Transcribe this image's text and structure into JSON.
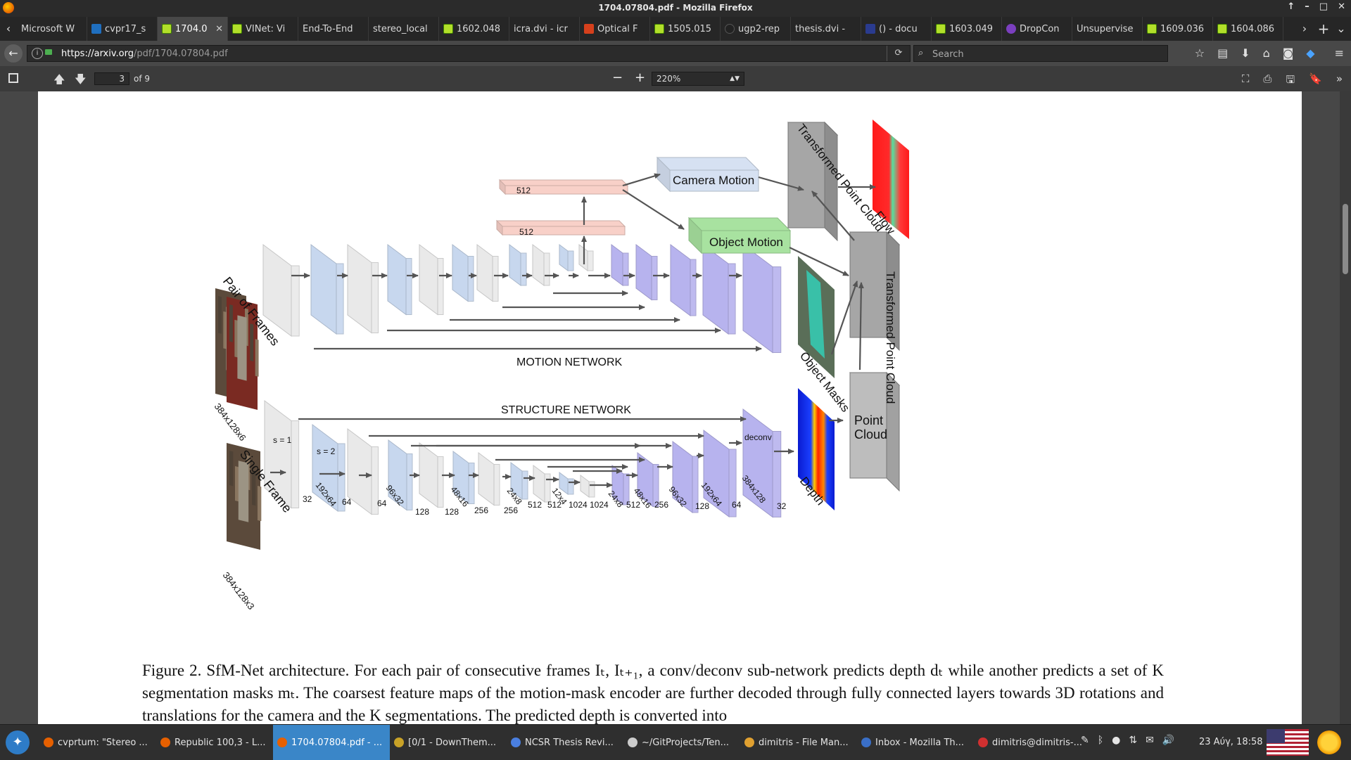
{
  "window": {
    "title": "1704.07804.pdf - Mozilla Firefox"
  },
  "tabs": [
    {
      "label": "Microsoft W",
      "icon": "none",
      "active": false
    },
    {
      "label": "cvpr17_s",
      "icon": "ieee",
      "active": false
    },
    {
      "label": "1704.0",
      "icon": "arxiv",
      "active": true
    },
    {
      "label": "VINet: Vi",
      "icon": "arxiv",
      "active": false
    },
    {
      "label": "End-To-End",
      "icon": "none",
      "active": false
    },
    {
      "label": "stereo_local",
      "icon": "none",
      "active": false
    },
    {
      "label": "1602.048",
      "icon": "arxiv",
      "active": false
    },
    {
      "label": "icra.dvi - icr",
      "icon": "none",
      "active": false
    },
    {
      "label": "Optical F",
      "icon": "r",
      "active": false
    },
    {
      "label": "1505.015",
      "icon": "arxiv",
      "active": false
    },
    {
      "label": "ugp2-rep",
      "icon": "github",
      "active": false
    },
    {
      "label": "thesis.dvi -",
      "icon": "none",
      "active": false
    },
    {
      "label": "() - docu",
      "icon": "hal",
      "active": false
    },
    {
      "label": "1603.049",
      "icon": "arxiv",
      "active": false
    },
    {
      "label": "DropCon",
      "icon": "drop",
      "active": false
    },
    {
      "label": "Unsupervise",
      "icon": "none",
      "active": false
    },
    {
      "label": "1609.036",
      "icon": "arxiv",
      "active": false
    },
    {
      "label": "1604.086",
      "icon": "arxiv",
      "active": false
    }
  ],
  "nav": {
    "url_host": "https://arxiv.org",
    "url_path": "/pdf/1704.07804.pdf",
    "search_placeholder": "Search"
  },
  "pdf": {
    "page_current": "3",
    "page_total": "of 9",
    "zoom": "220%"
  },
  "figure": {
    "labels": {
      "pair_of_frames": "Pair of Frames",
      "pair_dims": "384x128x6",
      "single_frame": "Single Frame",
      "single_dims": "384x128x3",
      "motion_network": "MOTION NETWORK",
      "structure_network": "STRUCTURE NETWORK",
      "camera_motion": "Camera Motion",
      "object_motion": "Object Motion",
      "fc1": "512",
      "fc2": "512",
      "transformed_pc_top": "Transformed Point Cloud",
      "transformed_pc_mid": "Transformed Point Cloud",
      "point_cloud": "Point Cloud",
      "flow": "Flow",
      "object_masks": "Object Masks",
      "depth": "Depth",
      "deconv": "deconv",
      "s1": "s = 1",
      "s2": "s = 2"
    },
    "bottom_numbers": [
      "32",
      "64",
      "64",
      "128",
      "128",
      "256",
      "256",
      "512",
      "512",
      "1024",
      "1024",
      "512",
      "256",
      "128",
      "64",
      "32"
    ],
    "bottom_dims": [
      "192x64",
      "96x32",
      "48x16",
      "24x8",
      "12x4",
      "24x8",
      "48x16",
      "96x32",
      "192x64",
      "384x128"
    ]
  },
  "caption": {
    "text": "Figure 2.  SfM-Net architecture. For each pair of consecutive frames Iₜ, Iₜ₊₁, a conv/deconv sub-network predicts depth dₜ while another predicts a set of K segmentation masks mₜ.  The coarsest feature maps of the motion-mask encoder are further decoded through fully connected layers towards 3D rotations and translations for the camera and the K segmentations.  The predicted depth is converted into"
  },
  "taskbar": {
    "tasks": [
      {
        "label": "cvprtum: \"Stereo ...",
        "color": "#e66000",
        "active": false
      },
      {
        "label": "Republic 100,3 - L...",
        "color": "#e66000",
        "active": false
      },
      {
        "label": "1704.07804.pdf - ...",
        "color": "#e66000",
        "active": true
      },
      {
        "label": "[0/1 - DownThem...",
        "color": "#c9a227",
        "active": false
      },
      {
        "label": "NCSR Thesis Revi...",
        "color": "#4a7fe0",
        "active": false
      },
      {
        "label": "~/GitProjects/Ten...",
        "color": "#cccccc",
        "active": false
      },
      {
        "label": "dimitris - File Man...",
        "color": "#e0a030",
        "active": false
      },
      {
        "label": "Inbox - Mozilla Th...",
        "color": "#3a6fc7",
        "active": false
      },
      {
        "label": "dimitris@dimitris-...",
        "color": "#d03030",
        "active": false
      }
    ],
    "clock": "23 Αύγ, 18:58"
  },
  "colors": {
    "accent": "#3a86c8",
    "conv_blue": "#c7d7ee",
    "conv_gray": "#e9e9e9",
    "deconv_purple": "#b7b3ee",
    "fc_pink": "#f8d0c8",
    "obj_motion_green": "#a8e2a0"
  }
}
